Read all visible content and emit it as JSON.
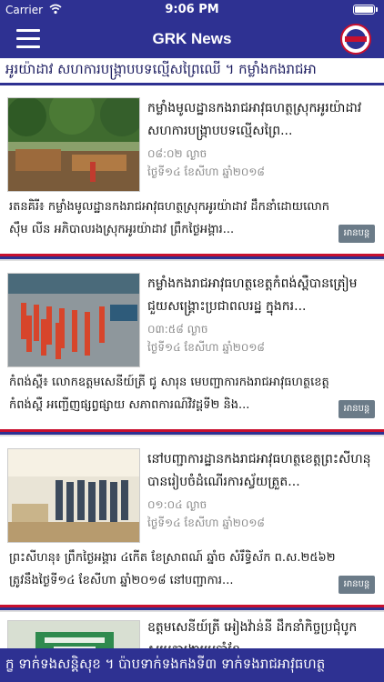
{
  "status_bar": {
    "carrier": "Carrier",
    "time": "9:06 PM"
  },
  "nav": {
    "title": "GRK News"
  },
  "ticker_top": "អូរយ៉ាដាវ សហការបង្រ្កាបបទល្មើសព្រៃឈើ ។ កម្លាំងកងរាជអា",
  "ticker_bottom": "ក្ខ ទាក់ទងសន្តិសុខ ។ ប៉ាបទាក់ទងកងទី៣ ទាក់ទងរាជអាវុធហត្ថ",
  "read_more_label": "អានបន្ត",
  "articles": [
    {
      "headline": "កម្លាំងមូលដ្ឋានកងរាជអាវុធហត្ថស្រុកអូរយ៉ាដាវ សហការបង្ក្រាបបទល្មើសព្រៃ...",
      "time": "០៨:០២ ល្ងាច",
      "date": "ថ្ងៃទី១៤ ខែសីហា ឆ្នាំ២០១៨",
      "summary": "រតនគិរី៖ កម្លាំងមូលដ្ឋានកងរាជអាវុធហត្ថស្រុកអូរយ៉ាដាវ ដឹកនាំដោយលោក ស៊ឹម លីន អភិបាលរងស្រុកអូរយ៉ាដាវ ព្រឹកថ្ងៃអង្គារ..."
    },
    {
      "headline": "កម្លាំងកងរាជអាវុធហត្ថខេត្តកំពង់ស្ពឺបានត្រៀម ជួយសង្គ្រោះប្រជាពលរដ្ឋ ក្នុងករ...",
      "time": "០៣:៥៨ ល្ងាច",
      "date": "ថ្ងៃទី១៤ ខែសីហា ឆ្នាំ២០១៨",
      "summary": "កំពង់ស្ពឺ៖ លោកឧត្តមសេនីយ៍ត្រី ជូ សារុន មេបញ្ជាការកងរាជអាវុធហត្ថខេត្តកំពង់ស្ពឺ អញ្ជើញផ្សព្វផ្សាយ សភាពការណ៍វិវដ្តទី២ និង..."
    },
    {
      "headline": "នៅបញ្ជាការដ្ឋានកងរាជអាវុធហត្ថខេត្តព្រះសីហនុ បានរៀបចំដំណើរការស្វ័យត្រួត...",
      "time": "០១:០៤ ល្ងាច",
      "date": "ថ្ងៃទី១៤ ខែសីហា ឆ្នាំ២០១៨",
      "summary": "ព្រះសីហនុ៖ ព្រឹកថ្ងៃអង្គារ ៤កើត ខែស្រាពណ៍ ឆ្នាំច សំរឹទ្ធិស័ក ព.ស.២៥៦២ ត្រូវនឹងថ្ងៃទី១៤ ខែសីហា ឆ្នាំ២០១៨ នៅបញ្ជាការ..."
    },
    {
      "headline": "ឧត្តមសេនីយ៍ត្រី អៀងវ៉ាន់នី ដឹកនាំកិច្ចប្រជុំបូកសរុបការងារប្រចាំខែ",
      "time": "",
      "date": "",
      "summary": ""
    }
  ]
}
